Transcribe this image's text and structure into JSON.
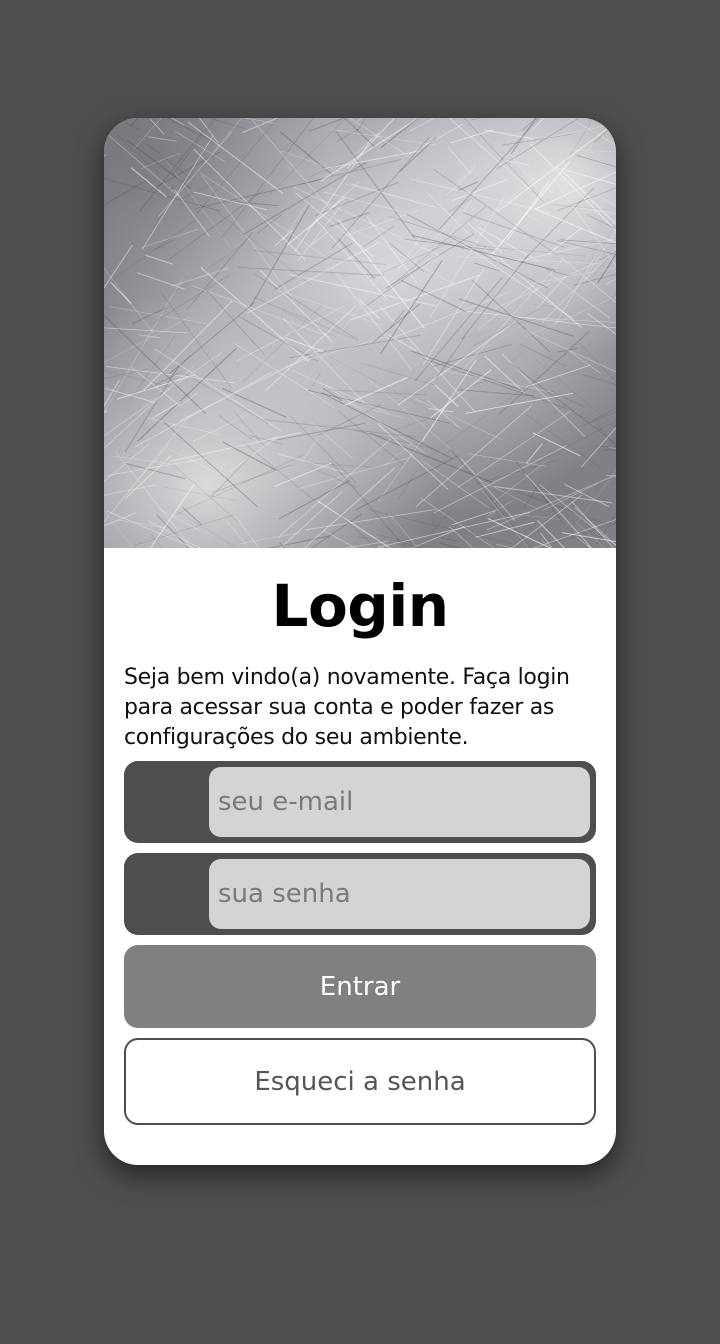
{
  "login": {
    "title": "Login",
    "description": "Seja bem vindo(a) novamente. Faça login para acessar sua conta e poder fazer as configurações do seu ambiente.",
    "email_placeholder": "seu e-mail",
    "password_placeholder": "sua senha",
    "submit_label": "Entrar",
    "forgot_label": "Esqueci a senha"
  },
  "colors": {
    "background": "#4e4e4e",
    "card": "#ffffff",
    "field_frame": "#4e4e4e",
    "field_fill": "#d4d4d4",
    "primary_button": "#808080",
    "secondary_border": "#4e4e4e"
  }
}
